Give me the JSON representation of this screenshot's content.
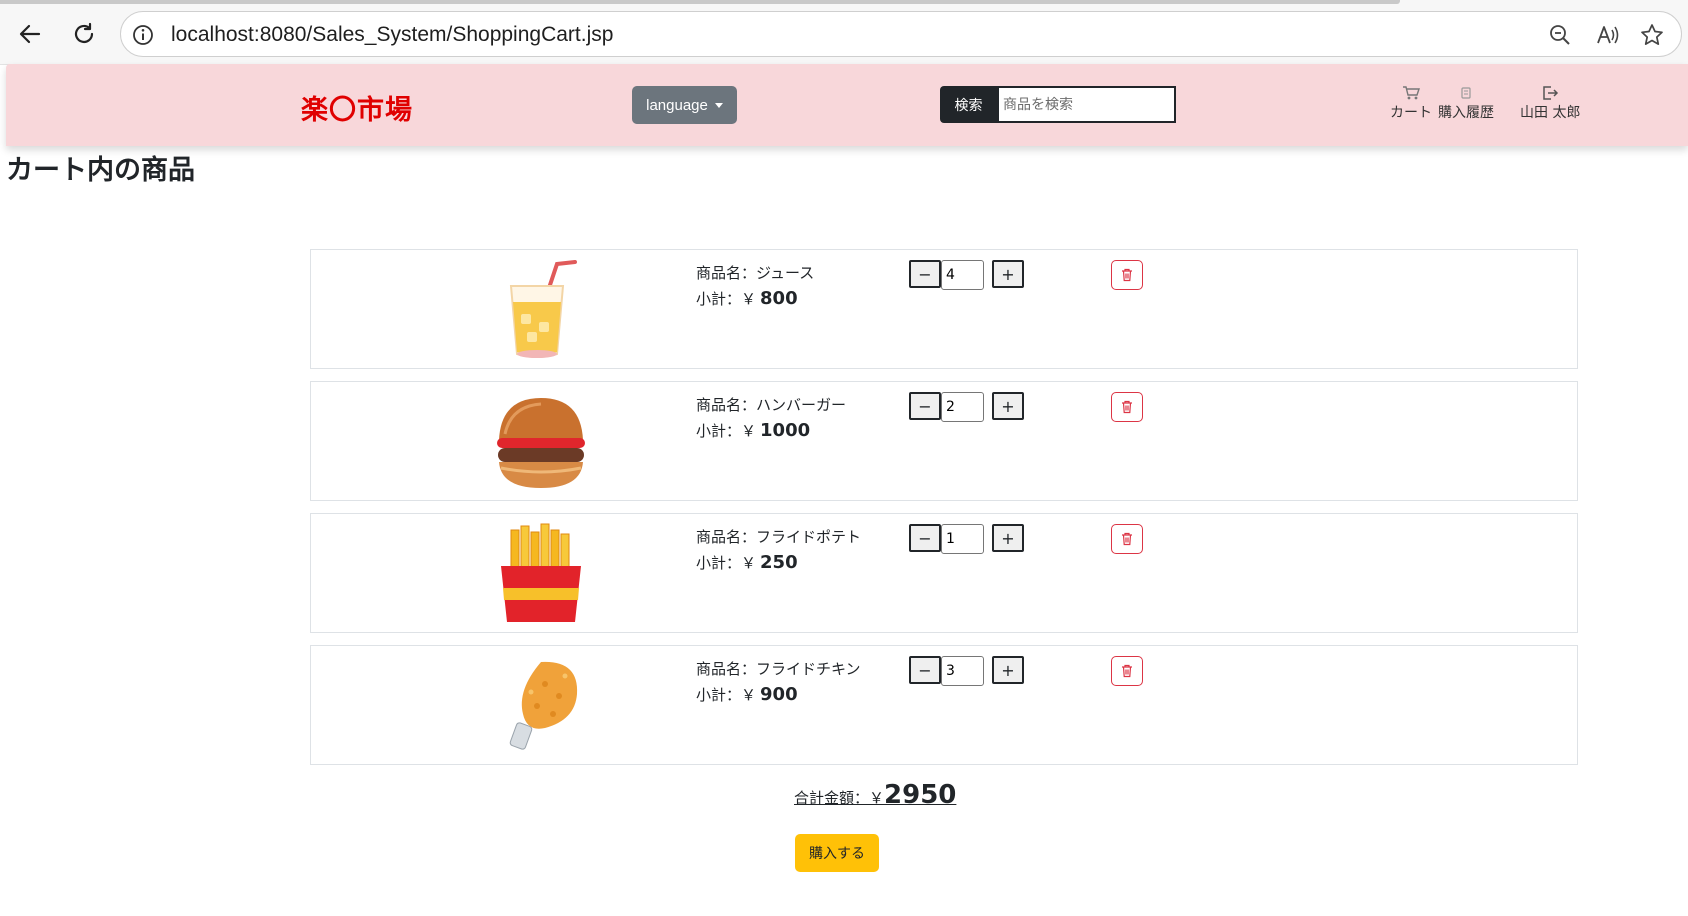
{
  "browser": {
    "url": "localhost:8080/Sales_System/ShoppingCart.jsp"
  },
  "header": {
    "logo": "楽〇市場",
    "language_label": "language",
    "search_button": "検索",
    "search_placeholder": "商品を検索",
    "nav": {
      "cart": "カート",
      "history": "購入履歴",
      "user": "山田 太郎"
    }
  },
  "page": {
    "title": "カート内の商品"
  },
  "cart": {
    "items": [
      {
        "name": "商品名：ジュース",
        "subtotal_label": "小計：￥",
        "subtotal": "800",
        "quantity": "4",
        "image": "juice"
      },
      {
        "name": "商品名：ハンバーガー",
        "subtotal_label": "小計：￥",
        "subtotal": "1000",
        "quantity": "2",
        "image": "hamburger"
      },
      {
        "name": "商品名：フライドポテト",
        "subtotal_label": "小計：￥",
        "subtotal": "250",
        "quantity": "1",
        "image": "french-fries"
      },
      {
        "name": "商品名：フライドチキン",
        "subtotal_label": "小計：￥",
        "subtotal": "900",
        "quantity": "3",
        "image": "fried-chicken"
      }
    ],
    "minus_label": "−",
    "plus_label": "+",
    "total_label": "合計金額：￥",
    "total_value": "2950",
    "buy_label": "購入する"
  }
}
